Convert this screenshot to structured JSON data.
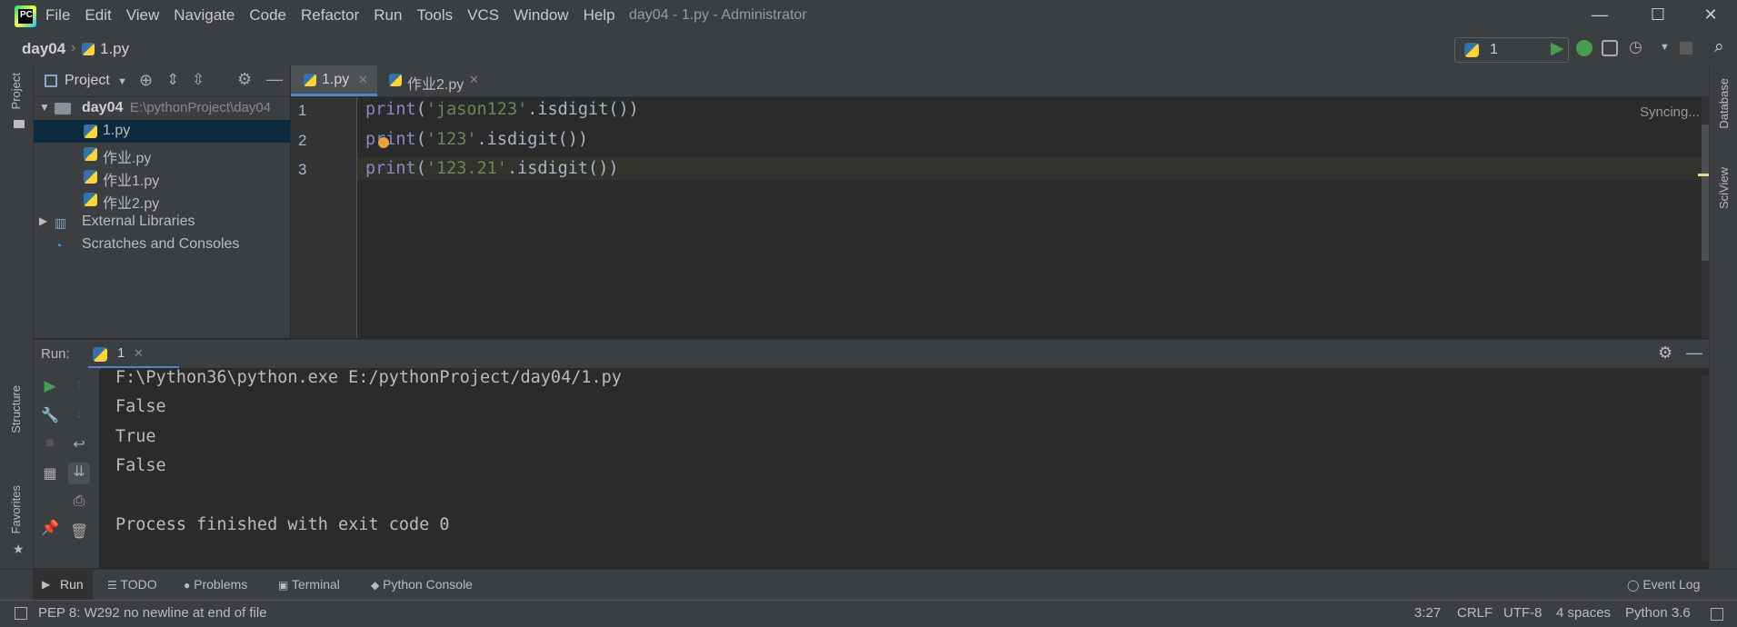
{
  "titlebar": {
    "menu": [
      "File",
      "Edit",
      "View",
      "Navigate",
      "Code",
      "Refactor",
      "Run",
      "Tools",
      "VCS",
      "Window",
      "Help"
    ],
    "title": "day04 - 1.py - Administrator",
    "minimize": "—",
    "maximize": "☐",
    "close": "✕"
  },
  "navbar": {
    "breadcrumb_project": "day04",
    "breadcrumb_file": "1.py",
    "run_config": "1"
  },
  "left_strip": {
    "project_label": "Project",
    "structure_label": "Structure",
    "favorites_label": "Favorites"
  },
  "right_strip": {
    "database_label": "Database",
    "sciview_label": "SciView"
  },
  "project": {
    "header_label": "Project",
    "root_name": "day04",
    "root_path": "E:\\pythonProject\\day04",
    "files": [
      "1.py",
      "作业.py",
      "作业1.py",
      "作业2.py"
    ],
    "external_libraries": "External Libraries",
    "scratches": "Scratches and Consoles"
  },
  "editor": {
    "tabs": [
      {
        "label": "1.py",
        "close": "✕"
      },
      {
        "label": "作业2.py",
        "close": "✕"
      }
    ],
    "status": "Syncing...",
    "line_numbers": [
      "1",
      "2",
      "3"
    ],
    "lines": [
      {
        "kw": "print",
        "open": "(",
        "str": "'jason123'",
        "rest": ".isdigit())"
      },
      {
        "kw": "print",
        "open": "(",
        "str": "'123'",
        "rest": ".isdigit())"
      },
      {
        "kw": "print",
        "open": "(",
        "str": "'123.21'",
        "rest": ".isdigit())"
      }
    ]
  },
  "run": {
    "label": "Run:",
    "tab_label": "1",
    "tab_close": "✕",
    "output": [
      "F:\\Python36\\python.exe E:/pythonProject/day04/1.py",
      "False",
      "True",
      "False",
      "",
      "Process finished with exit code 0"
    ]
  },
  "tool_tabs": {
    "run": "Run",
    "todo": "TODO",
    "problems": "Problems",
    "terminal": "Terminal",
    "python_console": "Python Console",
    "event_log": "Event Log"
  },
  "statusbar": {
    "message": "PEP 8: W292 no newline at end of file",
    "position": "3:27",
    "line_sep": "CRLF",
    "encoding": "UTF-8",
    "indent": "4 spaces",
    "interpreter": "Python 3.6"
  },
  "colors": {
    "keyword": "#8888c6",
    "string": "#6a8759",
    "run_green": "#499c54"
  }
}
